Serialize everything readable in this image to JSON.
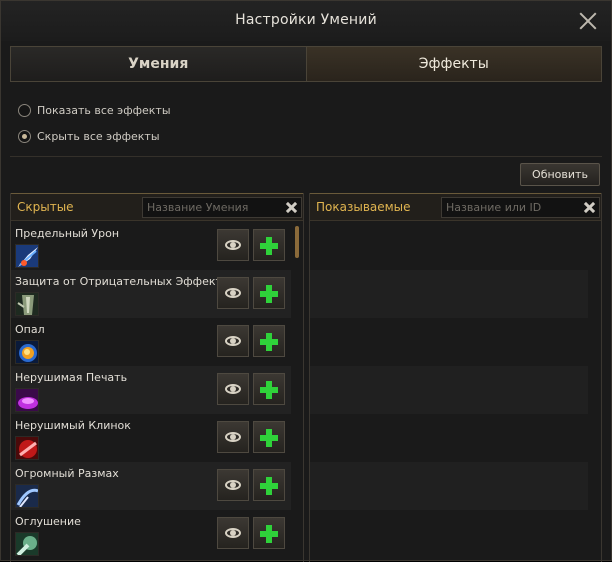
{
  "window": {
    "title": "Настройки Умений"
  },
  "tabs": [
    {
      "label": "Умения"
    },
    {
      "label": "Эффекты"
    }
  ],
  "options": {
    "show_all": "Показать все эффекты",
    "hide_all": "Скрыть все эффекты",
    "selected": "hide_all"
  },
  "refresh_label": "Обновить",
  "hidden_panel": {
    "title": "Скрытые",
    "search_placeholder": "Название Умения",
    "items": [
      {
        "name": "Предельный Урон",
        "icon": "ultimate-damage-icon"
      },
      {
        "name": "Защита от Отрицательных Эффектов",
        "icon": "debuff-protection-icon"
      },
      {
        "name": "Опал",
        "icon": "opal-icon"
      },
      {
        "name": "Нерушимая Печать",
        "icon": "unbreakable-seal-icon"
      },
      {
        "name": "Нерушимый Клинок",
        "icon": "unbreakable-blade-icon"
      },
      {
        "name": "Огромный Размах",
        "icon": "huge-swing-icon"
      },
      {
        "name": "Оглушение",
        "icon": "stun-icon"
      }
    ]
  },
  "shown_panel": {
    "title": "Показываемые",
    "search_placeholder": "Название или ID"
  },
  "colors": {
    "accent_gold": "#e0b450",
    "plus_green": "#2fd23a"
  }
}
